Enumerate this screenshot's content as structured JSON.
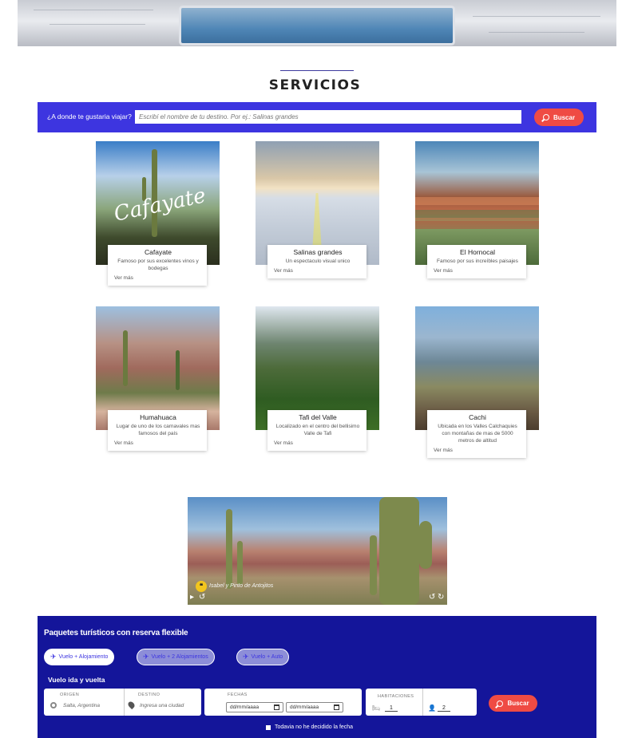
{
  "section": {
    "title": "SERVICIOS"
  },
  "search": {
    "label": "¿A donde te gustaria viajar?",
    "placeholder": "Escribí el nombre de tu destino. Por ej.: Salinas grandes",
    "button": "Buscar",
    "button_icon": "search-icon"
  },
  "destinations": [
    {
      "title": "Cafayate",
      "description": "Famoso por sus excelentes vinos y bodegas",
      "link": "Ver más",
      "image_text": "Cafayate"
    },
    {
      "title": "Salinas grandes",
      "description": "Un espectaculo visual unico",
      "link": "Ver más"
    },
    {
      "title": "El Hornocal",
      "description": "Famoso por sus increíbles paisajes",
      "link": "Ver más"
    },
    {
      "title": "Humahuaca",
      "description": "Lugar de uno de los carnavales mas famosos del país",
      "link": "Ver más"
    },
    {
      "title": "Tafi del Valle",
      "description": "Localizado en el centro del bellisimo Valle de Tafi",
      "link": "Ver más"
    },
    {
      "title": "Cachi",
      "description": "Ubicada en los Valles Calchaquies con montañas de mas de 5000 metros de altitud",
      "link": "Ver más"
    }
  ],
  "video": {
    "caption": "Isabel y Pinto de Antojitos"
  },
  "packages": {
    "title": "Paquetes turísticos con reserva flexible",
    "options": [
      {
        "label": "Vuelo + Alojamiento",
        "active": true
      },
      {
        "label": "Vuelo + 2 Alojamientos",
        "active": false
      },
      {
        "label": "Vuelo + Auto",
        "active": false
      }
    ],
    "trip_type": "Vuelo ida y vuelta",
    "origin": {
      "label": "ORIGEN",
      "value": "Salta, Argentina"
    },
    "destination": {
      "label": "DESTINO",
      "placeholder": "Ingresa una ciudad"
    },
    "dates": {
      "label": "FECHAS",
      "start": "dd/mm/aaaa",
      "end": "dd/mm/aaaa"
    },
    "rooms": {
      "label": "HABITACIONES",
      "rooms": "1",
      "guests": "2"
    },
    "button": "Buscar",
    "flexible_label": "Todavia no he decidido la fecha"
  },
  "colors": {
    "primary_blue": "#3d35e0",
    "dark_blue": "#14159a",
    "accent_red": "#ef4b44"
  }
}
